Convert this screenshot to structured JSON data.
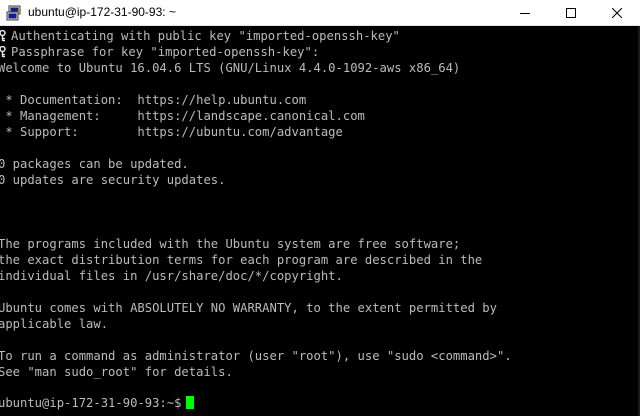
{
  "window": {
    "title": "ubuntu@ip-172-31-90-93: ~",
    "minimize_icon": "minimize-icon",
    "maximize_icon": "maximize-icon",
    "close_icon": "close-icon"
  },
  "terminal": {
    "lines": [
      "Authenticating with public key \"imported-openssh-key\"",
      "Passphrase for key \"imported-openssh-key\":",
      "Welcome to Ubuntu 16.04.6 LTS (GNU/Linux 4.4.0-1092-aws x86_64)",
      "",
      " * Documentation:  https://help.ubuntu.com",
      " * Management:     https://landscape.canonical.com",
      " * Support:        https://ubuntu.com/advantage",
      "",
      "0 packages can be updated.",
      "0 updates are security updates.",
      "",
      "",
      "",
      "The programs included with the Ubuntu system are free software;",
      "the exact distribution terms for each program are described in the",
      "individual files in /usr/share/doc/*/copyright.",
      "",
      "Ubuntu comes with ABSOLUTELY NO WARRANTY, to the extent permitted by",
      "applicable law.",
      "",
      "To run a command as administrator (user \"root\"), use \"sudo <command>\".",
      "See \"man sudo_root\" for details."
    ],
    "prompt": "ubuntu@ip-172-31-90-93:~$",
    "text_color": "#bbbbbb",
    "background_color": "#000000",
    "cursor_color": "#00ff00"
  }
}
